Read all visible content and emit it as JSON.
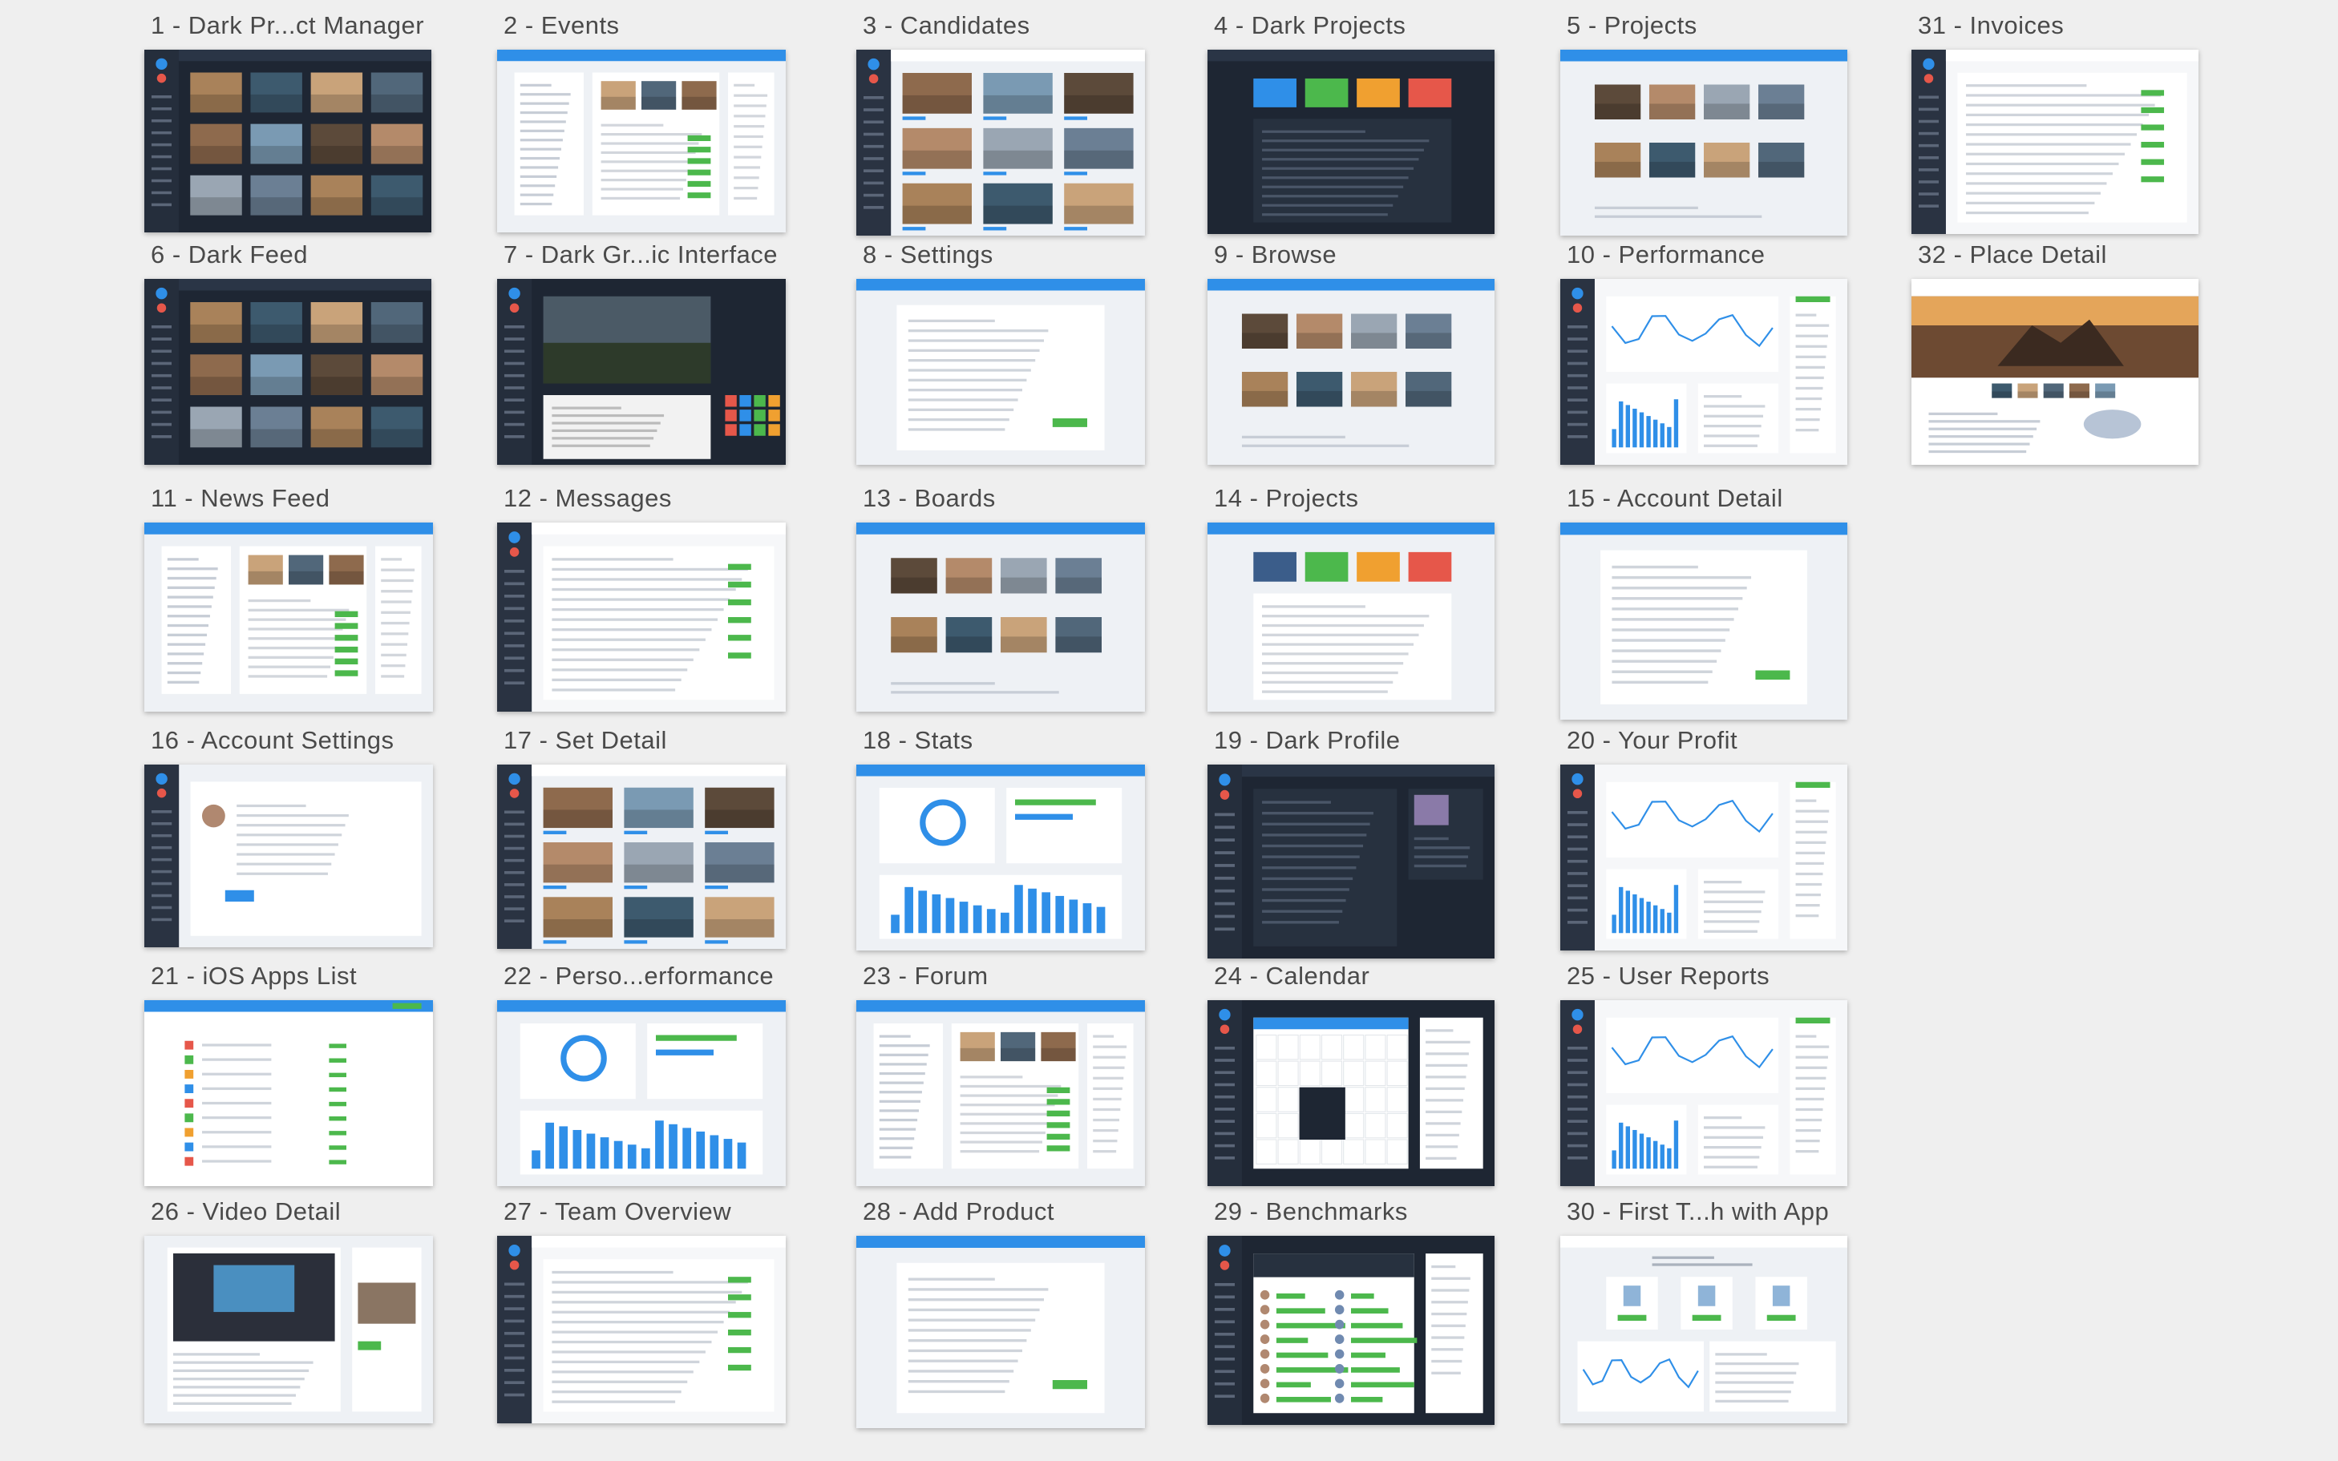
{
  "artboards": [
    {
      "label": "1 - Dark Pr...ct Manager",
      "theme": "dark-grid"
    },
    {
      "label": "2 - Events",
      "theme": "light-panels"
    },
    {
      "label": "3 - Candidates",
      "theme": "sidebar-grid"
    },
    {
      "label": "4 - Dark Projects",
      "theme": "dark-tiles"
    },
    {
      "label": "5 - Projects",
      "theme": "light-grid"
    },
    {
      "label": "31 - Invoices",
      "theme": "sidebar-table"
    },
    {
      "label": "6 - Dark Feed",
      "theme": "dark-grid"
    },
    {
      "label": "7 - Dark Gr...ic Interface",
      "theme": "dark-hero"
    },
    {
      "label": "8 - Settings",
      "theme": "light-form"
    },
    {
      "label": "9 - Browse",
      "theme": "light-grid"
    },
    {
      "label": "10 - Performance",
      "theme": "sidebar-chart"
    },
    {
      "label": "32 - Place Detail",
      "theme": "photo-hero"
    },
    {
      "label": "11 - News Feed",
      "theme": "light-panels"
    },
    {
      "label": "12 - Messages",
      "theme": "sidebar-table"
    },
    {
      "label": "13 - Boards",
      "theme": "light-grid"
    },
    {
      "label": "14 - Projects",
      "theme": "light-tiles"
    },
    {
      "label": "15 - Account Detail",
      "theme": "light-form"
    },
    {
      "label": "16 - Account Settings",
      "theme": "sidebar-form"
    },
    {
      "label": "17 - Set Detail",
      "theme": "sidebar-grid"
    },
    {
      "label": "18 - Stats",
      "theme": "light-chart"
    },
    {
      "label": "19 - Dark Profile",
      "theme": "dark-profile"
    },
    {
      "label": "20 - Your Profit",
      "theme": "sidebar-chart"
    },
    {
      "label": "21 - iOS Apps List",
      "theme": "light-list"
    },
    {
      "label": "22 - Perso...erformance",
      "theme": "light-chart"
    },
    {
      "label": "23 - Forum",
      "theme": "light-panels"
    },
    {
      "label": "24 - Calendar",
      "theme": "sidebar-calendar"
    },
    {
      "label": "25 - User Reports",
      "theme": "sidebar-chart"
    },
    {
      "label": "26 - Video Detail",
      "theme": "light-hero"
    },
    {
      "label": "27 - Team Overview",
      "theme": "sidebar-table"
    },
    {
      "label": "28 - Add Product",
      "theme": "light-form"
    },
    {
      "label": "29 - Benchmarks",
      "theme": "sidebar-bars"
    },
    {
      "label": "30 - First T...h with App",
      "theme": "light-cards"
    }
  ],
  "colors": {
    "background": "#efefef",
    "dark_panel": "#1e2633",
    "dark_sidebar": "#252e3c",
    "accent_blue": "#2f8fe8",
    "accent_green": "#4cb84c",
    "accent_orange": "#f0a030",
    "accent_red": "#e6574a",
    "light_panel": "#ffffff",
    "light_bg": "#eef1f5"
  }
}
